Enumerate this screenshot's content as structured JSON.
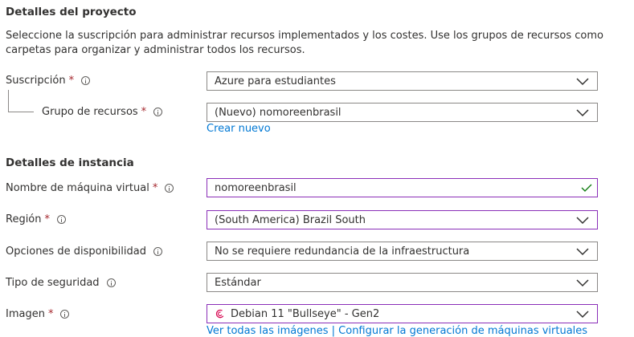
{
  "project": {
    "title": "Detalles del proyecto",
    "description": "Seleccione la suscripción para administrar recursos implementados y los costes. Use los grupos de recursos como carpetas para organizar y administrar todos los recursos."
  },
  "subscription": {
    "label": "Suscripción",
    "required": "*",
    "value": "Azure para estudiantes"
  },
  "resource_group": {
    "label": "Grupo de recursos",
    "required": "*",
    "value": "(Nuevo) nomoreenbrasil",
    "create_new_link": "Crear nuevo"
  },
  "instance": {
    "title": "Detalles de instancia"
  },
  "vm_name": {
    "label": "Nombre de máquina virtual",
    "required": "*",
    "value": "nomoreenbrasil"
  },
  "region": {
    "label": "Región",
    "required": "*",
    "value": "(South America) Brazil South"
  },
  "availability": {
    "label": "Opciones de disponibilidad",
    "value": "No se requiere redundancia de la infraestructura"
  },
  "security": {
    "label": "Tipo de seguridad",
    "value": "Estándar"
  },
  "image": {
    "label": "Imagen",
    "required": "*",
    "value": "Debian 11 \"Bullseye\" - Gen2",
    "links_text": "Ver todas las imágenes | Configurar la generación de máquinas virtuales"
  },
  "colors": {
    "accent": "#0078d4",
    "required": "#a4262c",
    "focus_border": "#8a2eb8",
    "valid_check": "#107c10",
    "debian": "#d70751"
  },
  "icons": {
    "info": "info-icon",
    "chevron": "chevron-down-icon",
    "check": "check-icon",
    "image": "debian-icon"
  }
}
